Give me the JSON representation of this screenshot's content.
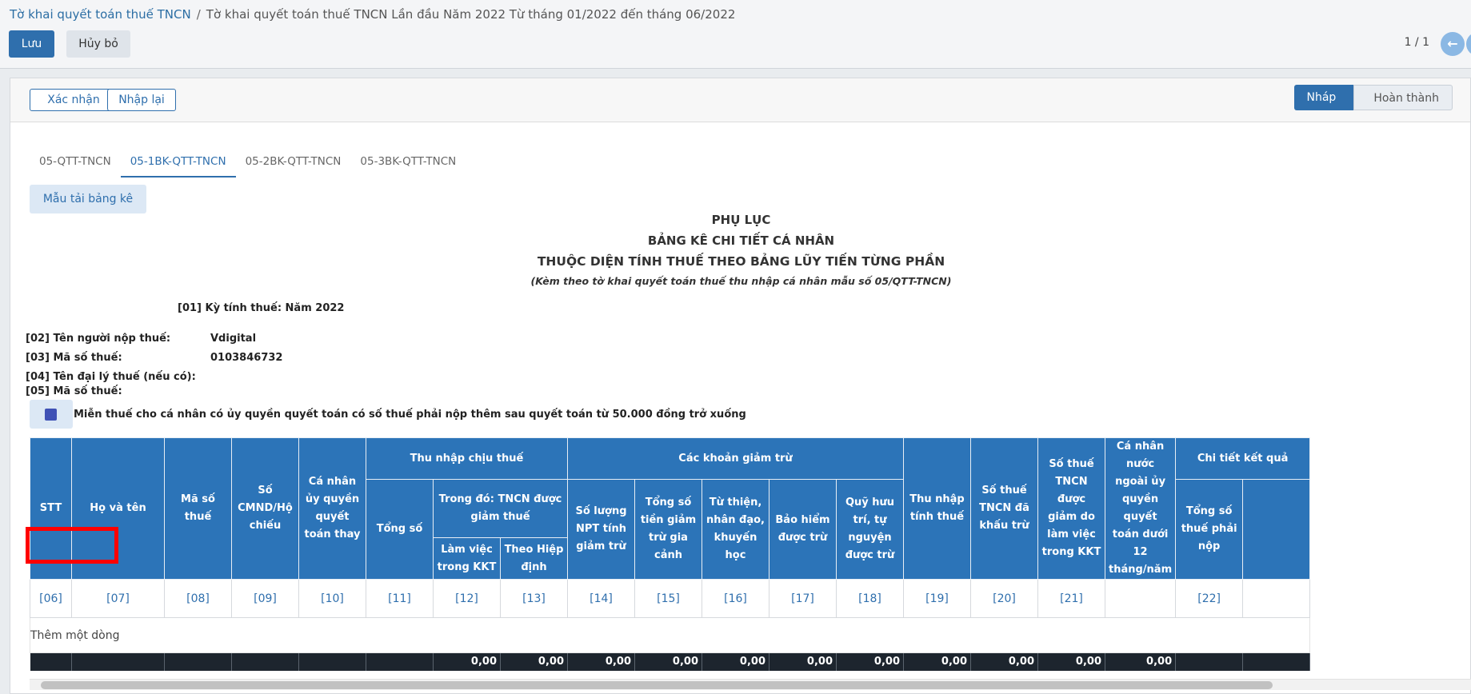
{
  "breadcrumb": {
    "parent": "Tờ khai quyết toán thuế TNCN",
    "current": "Tờ khai quyết toán thuế TNCN Lần đầu Năm 2022 Từ tháng 01/2022 đến tháng 06/2022"
  },
  "toolbar": {
    "save_label": "Lưu",
    "cancel_label": "Hủy bỏ",
    "pager": "1 / 1"
  },
  "form": {
    "confirm_label": "Xác nhận",
    "reset_label": "Nhập lại",
    "states": [
      "Nháp",
      "Hoàn thành"
    ],
    "active_state": "Nháp",
    "tabs": [
      "05-QTT-TNCN",
      "05-1BK-QTT-TNCN",
      "05-2BK-QTT-TNCN",
      "05-3BK-QTT-TNCN"
    ],
    "active_tab": "05-1BK-QTT-TNCN",
    "template_label": "Mẫu tải bảng kê"
  },
  "document": {
    "title1": "PHỤ LỤC",
    "title2": "BẢNG KÊ CHI TIẾT CÁ NHÂN",
    "title3": "THUỘC DIỆN TÍNH THUẾ THEO BẢNG LŨY TIẾN TỪNG PHẦN",
    "subtitle": "(Kèm theo tờ khai quyết toán thuế thu nhập cá nhân mẫu số 05/QTT-TNCN)",
    "period": "[01] Kỳ tính thuế: Năm 2022",
    "taxpayer_label": "[02] Tên người nộp thuế:",
    "taxpayer_value": "Vdigital",
    "tax_id_label": "[03] Mã số thuế:",
    "tax_id_value": "0103846732",
    "agent_label": "[04] Tên đại lý thuế (nếu có):",
    "agent_tax_id_label": "[05] Mã số thuế:",
    "exempt_label": "Miễn thuế cho cá nhân có ủy quyền quyết toán có số thuế phải nộp thêm sau quyết toán từ 50.000 đồng trở xuống",
    "exempt_checked": true
  },
  "table": {
    "headers": {
      "stt": "STT",
      "name": "Họ và tên",
      "tax_id": "Mã số thuế",
      "id_card": "Số CMND/Hộ chiếu",
      "authorized": "Cá nhân ủy quyền quyết toán thay",
      "taxable_income": "Thu nhập chịu thuế",
      "total": "Tổng số",
      "reduced": "Trong đó: TNCN được giảm thuế",
      "kkt": "Làm việc trong KKT",
      "treaty": "Theo Hiệp định",
      "deductions": "Các khoản giảm trừ",
      "npt": "Số lượng NPT tính giảm trừ",
      "family": "Tổng số tiền giảm trừ gia cảnh",
      "charity": "Từ thiện, nhân đạo, khuyến học",
      "insurance": "Bảo hiểm được trừ",
      "pension": "Quỹ hưu trí, tự nguyện được trừ",
      "assessable": "Thu nhập tính thuế",
      "withheld": "Số thuế TNCN đã khấu trừ",
      "reduced_kkt": "Số thuế TNCN được giảm do làm việc trong KKT",
      "foreign": "Cá nhân nước ngoài ủy quyền quyết toán dưới 12 tháng/năm",
      "result": "Chi tiết kết quả",
      "payable": "Tổng số thuế phải nộp"
    },
    "codes": [
      "[06]",
      "[07]",
      "[08]",
      "[09]",
      "[10]",
      "[11]",
      "[12]",
      "[13]",
      "[14]",
      "[15]",
      "[16]",
      "[17]",
      "[18]",
      "[19]",
      "[20]",
      "[21]",
      "",
      "[22]",
      ""
    ],
    "add_row_label": "Thêm một dòng",
    "totals": [
      "",
      "",
      "",
      "",
      "",
      "",
      "0,00",
      "0,00",
      "0,00",
      "0,00",
      "0,00",
      "0,00",
      "0,00",
      "0,00",
      "0,00",
      "0,00",
      "0,00",
      "",
      ""
    ]
  }
}
